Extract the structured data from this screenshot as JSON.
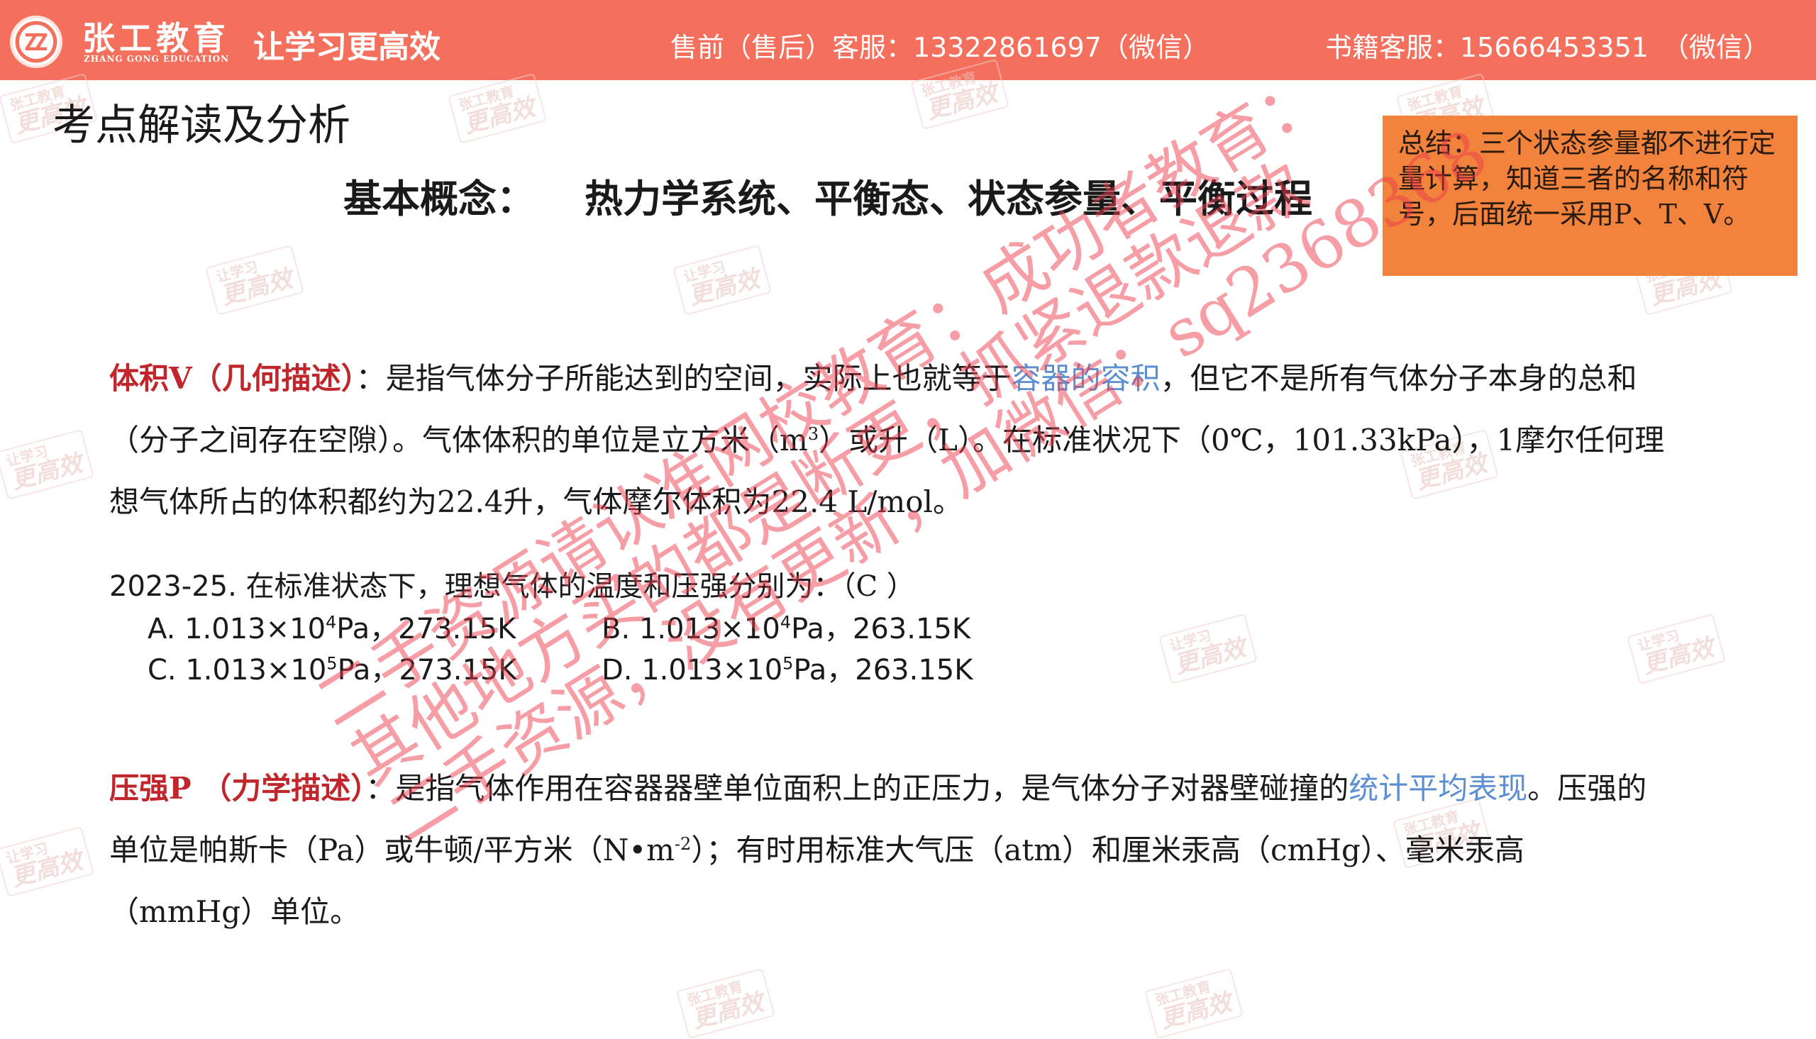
{
  "header": {
    "brand_cn": "张工教育",
    "brand_en": "ZHANG GONG EDUCATION",
    "slogan": "让学习更高效",
    "presale": "售前（售后）客服：13322861697（微信）",
    "books": "书籍客服：15666453351　（微信）",
    "logo_icon": "zz-logo-icon",
    "accent_color": "#f46f5c"
  },
  "page_title": "考点解读及分析",
  "concept": {
    "label": "基本概念：",
    "items": "热力学系统、平衡态、状态参量、平衡过程"
  },
  "summary": "总结：三个状态参量都不进行定量计算，知道三者的名称和符号，后面统一采用P、T、V。",
  "volume": {
    "term": "体积V（几何描述）",
    "t1": "：是指气体分子所能达到的空间，实际上也就等于",
    "hl": "容器的容积",
    "t2": "，但它不是所有气体分子本身的总和（分子之间存在空隙）。气体体积的单位是立方米（m",
    "sup": "3",
    "t3": "）或升（L）。在标准状况下（0℃，101.33kPa），1摩尔任何理想气体所占的体积都约为22.4升，气体摩尔体积为22.4 L/mol。"
  },
  "question": {
    "num": "2023-25.",
    "text": "在标准状态下，理想气体的温度和压强分别为：（C ）",
    "options": {
      "A_pre": "A. 1.013×10",
      "A_sup": "4",
      "A_post": "Pa，273.15K",
      "B_pre": "B. 1.013×10",
      "B_sup": "4",
      "B_post": "Pa，263.15K",
      "C_pre": "C. 1.013×10",
      "C_sup": "5",
      "C_post": "Pa，273.15K",
      "D_pre": "D. 1.013×10",
      "D_sup": "5",
      "D_post": "Pa，263.15K"
    }
  },
  "pressure": {
    "term": "压强P （力学描述）",
    "t1": "：是指气体作用在容器器壁单位面积上的正压力，是气体分子对器壁碰撞的",
    "hl": "统计平均表现",
    "t2": "。压强的单位是帕斯卡（Pa）或牛顿/平方米（N•m",
    "sup": "-2",
    "t3": "）；有时用标准大气压（atm）和厘米汞高（cmHg）、毫米汞高（mmHg）单位。"
  },
  "watermark": {
    "small": "张工教育",
    "small2": "让学习",
    "big": "更高效",
    "line1": "二手资源请认准网校教育：成功者教育：",
    "line2": "其他地方买的都是断更，抓紧退款退款",
    "line3": "二手资源，没有更新，加微信：sq2368368"
  }
}
